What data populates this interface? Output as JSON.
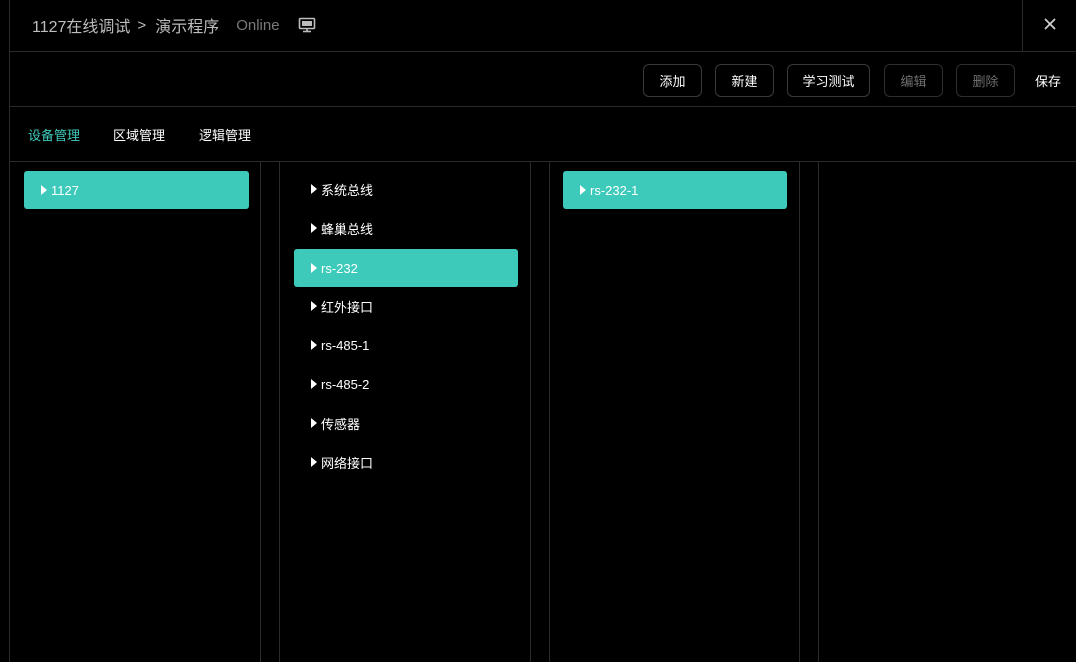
{
  "titlebar": {
    "breadcrumb_project": "1127在线调试",
    "breadcrumb_separator": ">",
    "breadcrumb_program": "演示程序",
    "status": "Online",
    "monitor_icon": "monitor-icon",
    "close_icon": "close-icon"
  },
  "toolbar": {
    "add_label": "添加",
    "new_label": "新建",
    "learn_test_label": "学习测试",
    "edit_label": "编辑",
    "delete_label": "删除",
    "save_label": "保存"
  },
  "tabs": [
    {
      "label": "设备管理",
      "active": true
    },
    {
      "label": "区域管理",
      "active": false
    },
    {
      "label": "逻辑管理",
      "active": false
    }
  ],
  "colors": {
    "accent": "#3ecabb",
    "background": "#000000",
    "divider": "#2a2a2a",
    "muted_text": "#bdbdbd",
    "disabled_text": "#6e6e6e"
  },
  "columns": {
    "devices": [
      {
        "label": "1127",
        "selected": true
      }
    ],
    "interfaces": [
      {
        "label": "系统总线",
        "selected": false
      },
      {
        "label": "蜂巢总线",
        "selected": false
      },
      {
        "label": "rs-232",
        "selected": true
      },
      {
        "label": "红外接口",
        "selected": false
      },
      {
        "label": "rs-485-1",
        "selected": false
      },
      {
        "label": "rs-485-2",
        "selected": false
      },
      {
        "label": "传感器",
        "selected": false
      },
      {
        "label": "网络接口",
        "selected": false
      }
    ],
    "ports": [
      {
        "label": "rs-232-1",
        "selected": true
      }
    ]
  }
}
